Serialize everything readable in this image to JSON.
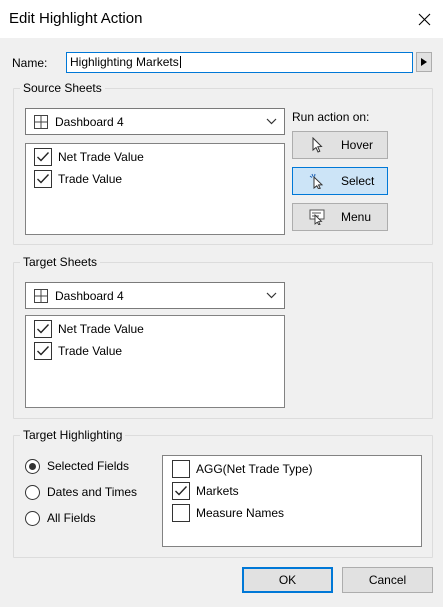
{
  "window": {
    "title": "Edit Highlight Action",
    "close_icon": "close-icon"
  },
  "name": {
    "label": "Name:",
    "value": "Highlighting Markets",
    "insert_menu_icon": "triangle-right-icon"
  },
  "source_sheets": {
    "title": "Source Sheets",
    "dropdown": {
      "icon": "dashboard-grid-icon",
      "value": "Dashboard 4"
    },
    "items": [
      {
        "label": "Net Trade Value",
        "checked": true
      },
      {
        "label": "Trade Value",
        "checked": true
      }
    ]
  },
  "run_action": {
    "label": "Run action on:",
    "buttons": [
      {
        "label": "Hover",
        "icon": "pointer-arrow-icon",
        "selected": false
      },
      {
        "label": "Select",
        "icon": "pointer-click-icon",
        "selected": true
      },
      {
        "label": "Menu",
        "icon": "pointer-menu-icon",
        "selected": false
      }
    ]
  },
  "target_sheets": {
    "title": "Target Sheets",
    "dropdown": {
      "icon": "dashboard-grid-icon",
      "value": "Dashboard 4"
    },
    "items": [
      {
        "label": "Net Trade Value",
        "checked": true
      },
      {
        "label": "Trade Value",
        "checked": true
      }
    ]
  },
  "target_highlighting": {
    "title": "Target Highlighting",
    "options": [
      {
        "label": "Selected Fields",
        "selected": true
      },
      {
        "label": "Dates and Times",
        "selected": false
      },
      {
        "label": "All Fields",
        "selected": false
      }
    ],
    "fields": [
      {
        "label": "AGG(Net Trade Type)",
        "checked": false
      },
      {
        "label": "Markets",
        "checked": true
      },
      {
        "label": "Measure Names",
        "checked": false
      }
    ]
  },
  "footer": {
    "ok_label": "OK",
    "cancel_label": "Cancel"
  },
  "colors": {
    "accent": "#0078d7",
    "selected_button_bg": "#cce4f7",
    "dialog_bg": "#f0f0f0"
  }
}
